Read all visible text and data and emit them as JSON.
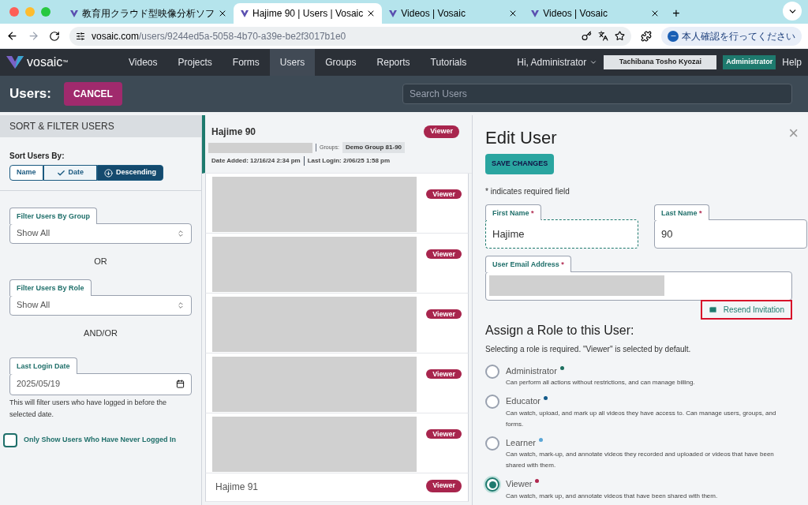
{
  "browser": {
    "tabs": [
      {
        "title": "教育用クラウド型映像分析ソフ",
        "selected": false
      },
      {
        "title": "Hajime 90 | Users | Vosaic",
        "selected": true
      },
      {
        "title": "Videos | Vosaic",
        "selected": false
      },
      {
        "title": "Videos | Vosaic",
        "selected": false
      }
    ],
    "new_tab": "+",
    "url_host": "vosaic.com",
    "url_path": "/users/9244ed5a-5058-4b70-a39e-be2f3017b1e0",
    "profile_button": "本人確認を行ってください"
  },
  "nav": {
    "logo": "vosaic",
    "logo_tm": "™",
    "items": [
      {
        "label": "Videos",
        "selected": false
      },
      {
        "label": "Projects",
        "selected": false
      },
      {
        "label": "Forms",
        "selected": false
      },
      {
        "label": "Users",
        "selected": true
      },
      {
        "label": "Groups",
        "selected": false
      },
      {
        "label": "Reports",
        "selected": false
      },
      {
        "label": "Tutorials",
        "selected": false
      }
    ],
    "greeting": "Hi, Administrator",
    "org": "Tachibana Tosho Kyozai",
    "role_badge": "Administrator",
    "help": "Help"
  },
  "header": {
    "title": "Users:",
    "cancel": "CANCEL",
    "search_placeholder": "Search Users"
  },
  "sidebar": {
    "title": "SORT & FILTER USERS",
    "sort_label": "Sort Users By:",
    "sort_buttons": [
      {
        "label": "Name",
        "selected": false,
        "kind": "plain"
      },
      {
        "label": "Date",
        "selected": true,
        "kind": "check"
      },
      {
        "label": "Descending",
        "selected": true,
        "kind": "direction"
      }
    ],
    "group_filter": {
      "label": "Filter Users By Group",
      "value": "Show All"
    },
    "or": "OR",
    "role_filter": {
      "label": "Filter Users By Role",
      "value": "Show All"
    },
    "andor": "AND/OR",
    "login_date": {
      "label": "Last Login Date",
      "value": "2025/05/19",
      "help": "This will filter users who have logged in before the selected date."
    },
    "never_logged": {
      "label": "Only Show Users Who Have Never Logged In",
      "checked": false
    }
  },
  "users": [
    {
      "kind": "full",
      "name": "Hajime 90",
      "role": "Viewer",
      "selected": true,
      "groups_label": "Groups:",
      "group": "Demo Group 81-90",
      "added": "Date Added: 12/16/24 2:34 pm",
      "login": "Last Login: 2/06/25 1:58 pm"
    },
    {
      "kind": "redacted",
      "role": "Viewer",
      "selected": false
    },
    {
      "kind": "redacted",
      "role": "Viewer",
      "selected": false
    },
    {
      "kind": "redacted",
      "role": "Viewer",
      "selected": false
    },
    {
      "kind": "redacted",
      "role": "Viewer",
      "selected": false
    },
    {
      "kind": "redacted",
      "role": "Viewer",
      "selected": false
    },
    {
      "kind": "name_only",
      "name": "Hajime 91",
      "role": "Viewer",
      "selected": false
    }
  ],
  "edit": {
    "title": "Edit User",
    "close": "×",
    "required_mark": "*",
    "save": "SAVE CHANGES",
    "required_note": "* indicates required field",
    "first_name": {
      "label": "First Name",
      "value": "Hajime"
    },
    "last_name": {
      "label": "Last Name",
      "value": "90"
    },
    "email": {
      "label": "User Email Address"
    },
    "resend": "Resend Invitation",
    "role_heading": "Assign a Role to this User:",
    "role_note": "Selecting a role is required. \"Viewer\" is selected by default.",
    "roles": [
      {
        "name": "Administrator",
        "color": "#1d6f5f",
        "selected": false,
        "description": "Can perform all actions without restrictions, and can manage billing."
      },
      {
        "name": "Educator",
        "color": "#135a8a",
        "selected": false,
        "description": "Can watch, upload, and mark up all videos they have access to. Can manage users, groups, and forms."
      },
      {
        "name": "Learner",
        "color": "#5aa6d6",
        "selected": false,
        "description": "Can watch, mark-up, and annotate videos they recorded and uploaded or videos that have been shared with them."
      },
      {
        "name": "Viewer",
        "color": "#b0284f",
        "selected": true,
        "description": "Can watch, mark up, and annotate videos that have been shared with them."
      }
    ]
  }
}
